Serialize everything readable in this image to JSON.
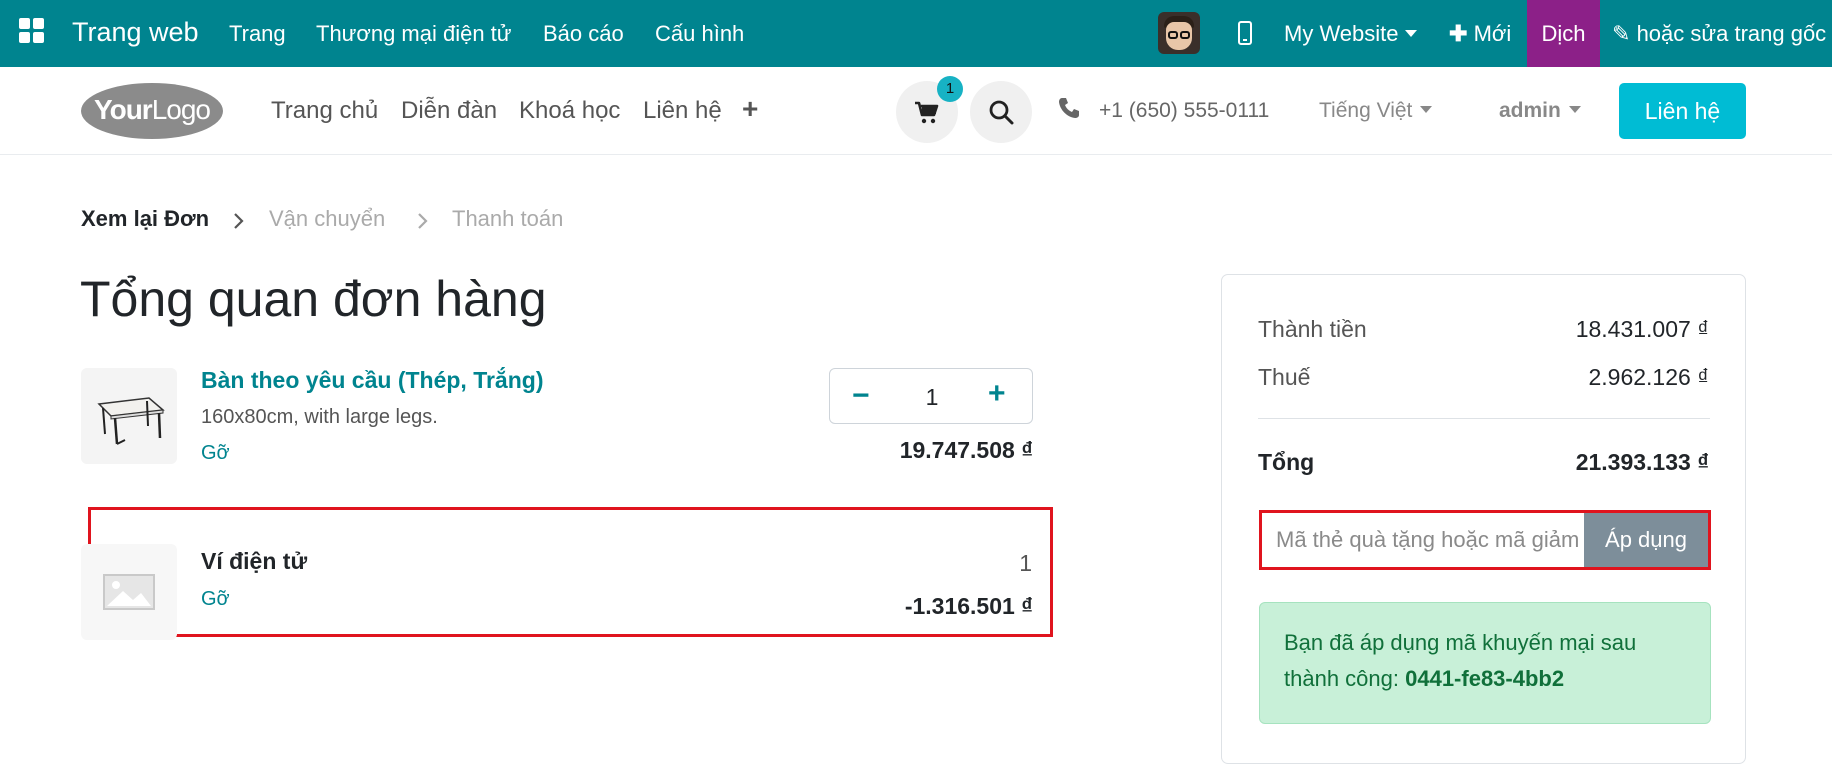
{
  "admin_bar": {
    "app_title": "Trang web",
    "menus": [
      "Trang",
      "Thương mại điện tử",
      "Báo cáo",
      "Cấu hình"
    ],
    "website_selector": "My Website",
    "new_label": "Mới",
    "translate_label": "Dịch",
    "edit_label": "hoặc sửa trang gốc",
    "colors": {
      "bar": "#00848f",
      "translate": "#8c2088"
    }
  },
  "header": {
    "logo_text": "YourLogo",
    "nav": [
      "Trang chủ",
      "Diễn đàn",
      "Khoá học",
      "Liên hệ"
    ],
    "cart_count": "1",
    "phone": "+1 (650) 555-0111",
    "language": "Tiếng Việt",
    "user": "admin",
    "contact_button": "Liên hệ"
  },
  "breadcrumb": {
    "steps": [
      "Xem lại Đơn",
      "Vận chuyển",
      "Thanh toán"
    ],
    "active_index": 0
  },
  "page_title": "Tổng quan đơn hàng",
  "order_lines": [
    {
      "name": "Bàn theo yêu cầu (Thép, Trắng)",
      "description": "160x80cm, with large legs.",
      "remove_label": "Gỡ",
      "quantity": "1",
      "price": "19.747.508 ₫",
      "icon": "table-product-image"
    },
    {
      "name": "Ví điện tử",
      "remove_label": "Gỡ",
      "quantity": "1",
      "price": "-1.316.501 ₫",
      "icon": "image-placeholder-icon"
    }
  ],
  "summary": {
    "subtotal_label": "Thành tiền",
    "subtotal_value": "18.431.007 ₫",
    "tax_label": "Thuế",
    "tax_value": "2.962.126 ₫",
    "total_label": "Tổng",
    "total_value": "21.393.133 ₫",
    "promo_placeholder": "Mã thẻ quà tặng hoặc mã giảm giá",
    "apply_label": "Áp dụng",
    "alert_text": "Bạn đã áp dụng mã khuyến mại sau thành công:",
    "alert_code": "0441-fe83-4bb2"
  }
}
